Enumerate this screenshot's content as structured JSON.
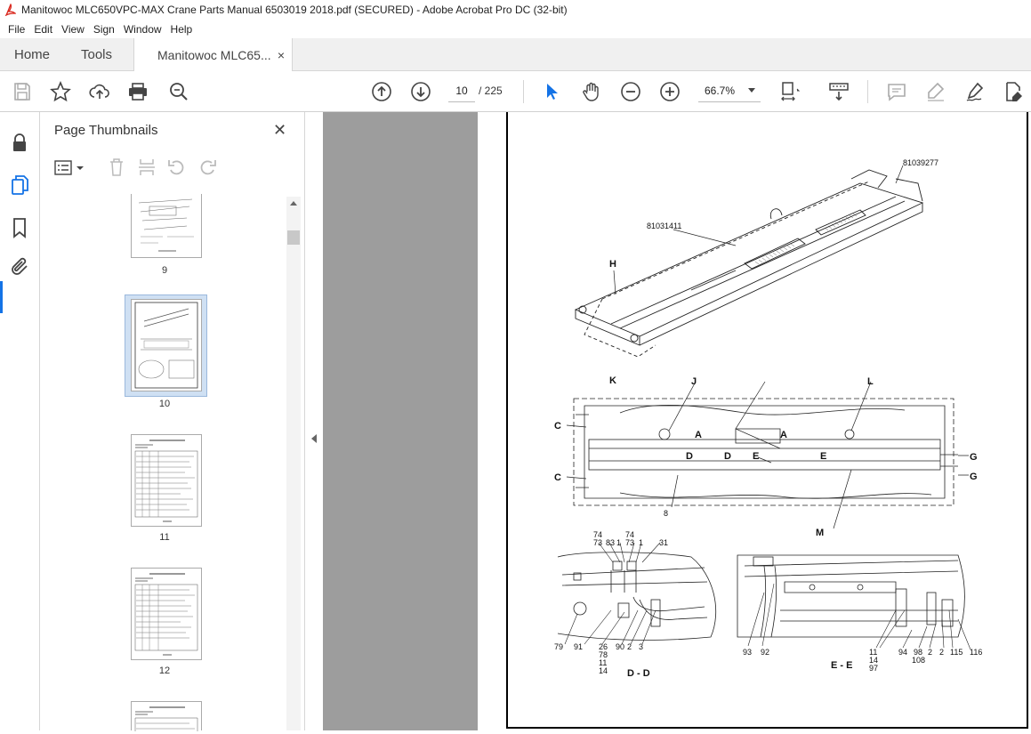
{
  "window": {
    "title": "Manitowoc MLC650VPC-MAX Crane Parts Manual 6503019 2018.pdf (SECURED) - Adobe Acrobat Pro DC (32-bit)"
  },
  "menu": [
    "File",
    "Edit",
    "View",
    "Sign",
    "Window",
    "Help"
  ],
  "tabs": {
    "home": "Home",
    "tools": "Tools",
    "document": "Manitowoc MLC65...",
    "close_symbol": "×"
  },
  "toolbar": {
    "current_page": "10",
    "total_pages": "/ 225",
    "zoom": "66.7%"
  },
  "thumbnails_panel": {
    "title": "Page Thumbnails",
    "close_symbol": "✕",
    "pages": [
      {
        "number": "9"
      },
      {
        "number": "10",
        "selected": true
      },
      {
        "number": "11"
      },
      {
        "number": "12"
      }
    ]
  },
  "drawing": {
    "part_numbers": [
      "81039277",
      "81031411"
    ],
    "view_letters": [
      "H",
      "K",
      "J",
      "L",
      "C",
      "C",
      "A",
      "A",
      "D",
      "D",
      "E",
      "E",
      "G",
      "G",
      "M"
    ],
    "center_callout": "8",
    "dd_callouts_top": [
      "74",
      "73",
      "83",
      "1",
      "74",
      "73",
      "1",
      "31"
    ],
    "dd_callouts_bottom": [
      "79",
      "91",
      "26",
      "78",
      "11",
      "14",
      "90",
      "2",
      "3"
    ],
    "dd_section": "D - D",
    "ee_callouts": [
      "93",
      "92",
      "11",
      "14",
      "97",
      "94",
      "98",
      "108",
      "2",
      "2",
      "115",
      "116"
    ],
    "ee_section": "E - E"
  },
  "colors": {
    "accent": "#1473e6",
    "doc_background": "#9d9d9d",
    "pdf_red": "#d9261c"
  }
}
